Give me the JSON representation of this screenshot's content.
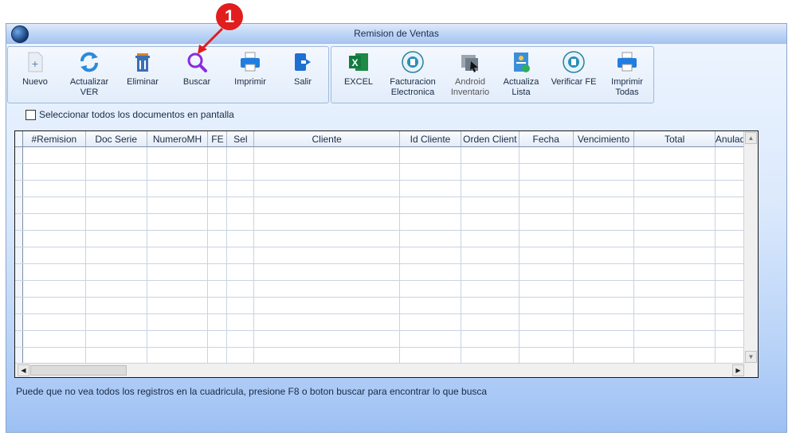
{
  "window": {
    "title": "Remision de Ventas"
  },
  "annotation": {
    "badge": "1"
  },
  "toolbar1": [
    {
      "id": "nuevo",
      "label": "Nuevo",
      "icon": "new-document-icon"
    },
    {
      "id": "actualizar",
      "label": "Actualizar\nVER",
      "icon": "refresh-icon"
    },
    {
      "id": "eliminar",
      "label": "Eliminar",
      "icon": "trash-icon"
    },
    {
      "id": "buscar",
      "label": "Buscar",
      "icon": "search-icon"
    },
    {
      "id": "imprimir",
      "label": "Imprimir",
      "icon": "printer-icon"
    },
    {
      "id": "salir",
      "label": "Salir",
      "icon": "exit-icon"
    }
  ],
  "toolbar2": [
    {
      "id": "excel",
      "label": "EXCEL",
      "icon": "excel-icon"
    },
    {
      "id": "facturacion",
      "label": "Facturacion\nElectronica",
      "icon": "facturacion-electronica-icon"
    },
    {
      "id": "android",
      "label": "Android\nInventario",
      "icon": "android-inventario-icon",
      "disabled": true
    },
    {
      "id": "actualiza-lista",
      "label": "Actualiza\nLista",
      "icon": "update-list-icon"
    },
    {
      "id": "verificar-fe",
      "label": "Verificar FE",
      "icon": "verify-fe-icon"
    },
    {
      "id": "imprimir-todas",
      "label": "Imprimir\nTodas",
      "icon": "print-all-icon"
    }
  ],
  "icon_text": {
    "excel": "X"
  },
  "select_all": {
    "label": "Seleccionar todos los documentos en pantalla",
    "checked": false
  },
  "grid": {
    "columns": [
      "#Remision",
      "Doc Serie",
      "NumeroMH",
      "FE",
      "Sel",
      "Cliente",
      "Id Cliente",
      "Orden Client",
      "Fecha",
      "Vencimiento",
      "Total",
      "AnuladoE"
    ],
    "rows": []
  },
  "status": {
    "message": "Puede que no vea todos los registros en la cuadricula, presione F8 o boton buscar para encontrar lo que busca"
  },
  "colors": {
    "accent": "#e11d1d",
    "window_gradient_bottom": "#9dc0f4"
  }
}
